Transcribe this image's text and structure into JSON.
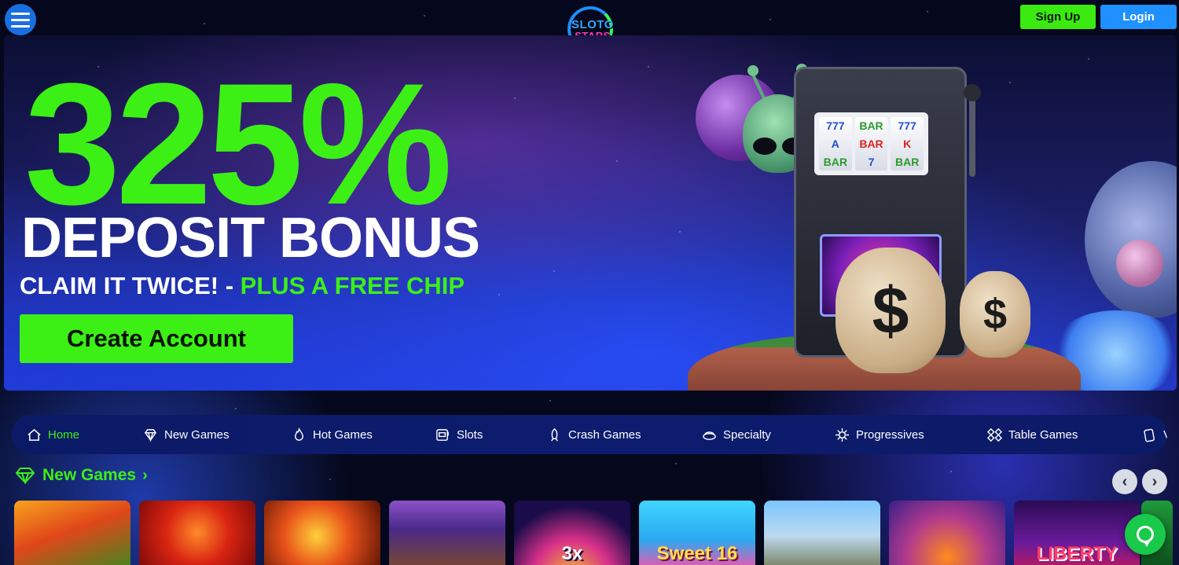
{
  "header": {
    "logo": {
      "line1": "SLOTO",
      "line2": "STARS"
    },
    "signup_label": "Sign Up",
    "login_label": "Login"
  },
  "hero": {
    "headline": "325%",
    "subheadline": "DEPOSIT BONUS",
    "claim_white": "CLAIM IT TWICE! - ",
    "claim_green": "PLUS A FREE CHIP",
    "cta_label": "Create Account",
    "reels": [
      [
        "777",
        "A",
        "BAR"
      ],
      [
        "BAR",
        "BAR",
        "7"
      ],
      [
        "777",
        "K",
        "BAR"
      ]
    ],
    "bag_symbol": "$"
  },
  "nav": {
    "items": [
      {
        "label": "Home",
        "icon": "home-icon",
        "active": true
      },
      {
        "label": "New Games",
        "icon": "diamond-icon",
        "active": false
      },
      {
        "label": "Hot Games",
        "icon": "flame-icon",
        "active": false
      },
      {
        "label": "Slots",
        "icon": "slot-machine-icon",
        "active": false
      },
      {
        "label": "Crash Games",
        "icon": "rocket-icon",
        "active": false
      },
      {
        "label": "Specialty",
        "icon": "specialty-icon",
        "active": false
      },
      {
        "label": "Progressives",
        "icon": "progressive-icon",
        "active": false
      },
      {
        "label": "Table Games",
        "icon": "cards-icon",
        "active": false
      },
      {
        "label": "V",
        "icon": "video-poker-icon",
        "active": false
      }
    ]
  },
  "new_games": {
    "title": "New Games",
    "tiles": [
      {
        "name": "dino",
        "tag": ""
      },
      {
        "name": "devil",
        "tag": ""
      },
      {
        "name": "fire-bull",
        "tag": ""
      },
      {
        "name": "buffalo",
        "tag": ""
      },
      {
        "name": "wheel",
        "tag": "3x"
      },
      {
        "name": "sweet",
        "tag": "Sweet 16"
      },
      {
        "name": "oz",
        "tag": ""
      },
      {
        "name": "pumpkin",
        "tag": ""
      },
      {
        "name": "liberty",
        "tag": "LIBERTY"
      }
    ]
  },
  "colors": {
    "accent_green": "#3cf016",
    "login_blue": "#1e90ff",
    "nav_bg": "#0d1c6e",
    "page_bg": "#05081c"
  }
}
